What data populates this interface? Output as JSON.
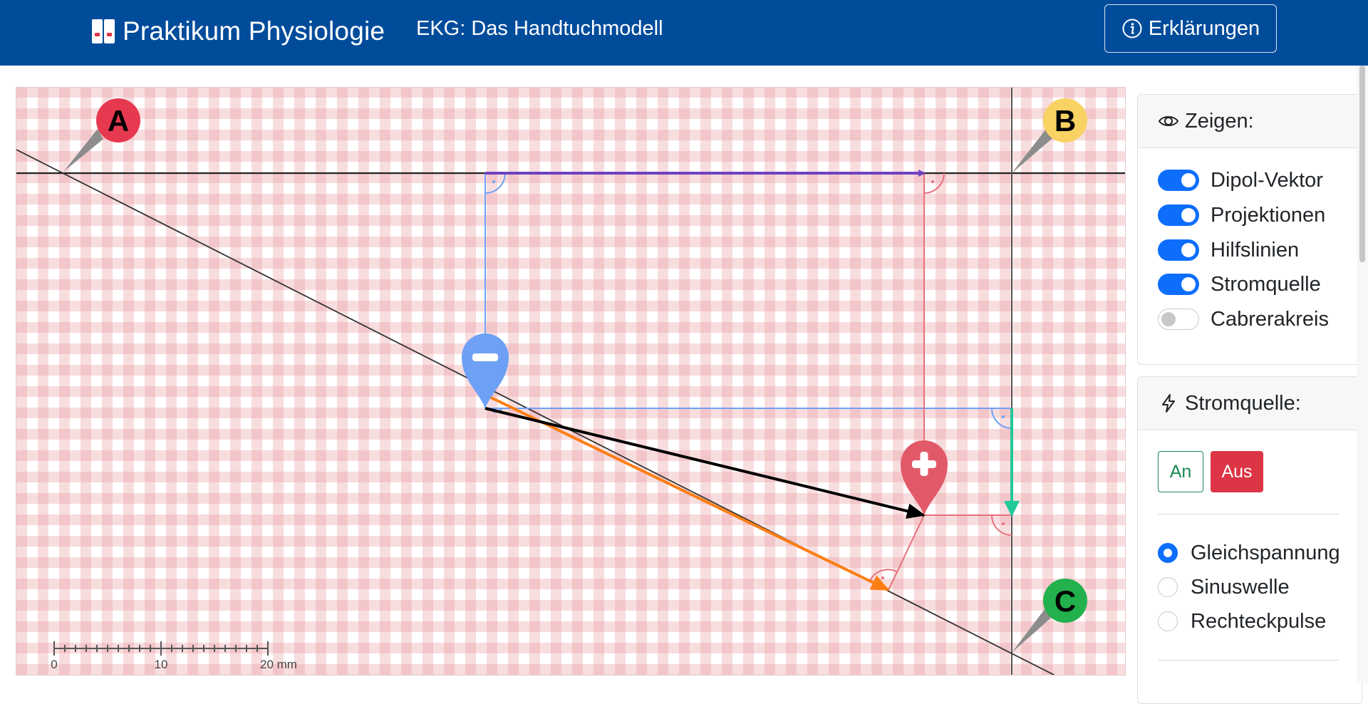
{
  "navbar": {
    "brand": "Praktikum Physiologie",
    "subtitle": "EKG: Das Handtuchmodell",
    "explain_button": "Erklärungen",
    "background_color": "#004c9b"
  },
  "canvas": {
    "markers": {
      "a": "A",
      "b": "B",
      "c": "C",
      "a_color": "#e63950",
      "b_color": "#f8d262",
      "c_color": "#22b14c"
    },
    "dipole_poles": {
      "negative_icon": "minus-icon",
      "positive_icon": "plus-icon",
      "negative_color": "#6ea1f5",
      "positive_color": "#e25a6a"
    },
    "vector_colors": {
      "dipole": "#000000",
      "projection_ab": "#6f42c1",
      "projection_bc": "#20c997",
      "projection_ac": "#fd7e14",
      "helper_blue": "#6ea1f5",
      "helper_red": "#e8707c"
    },
    "scale": {
      "tick0": "0",
      "tick10": "10",
      "tick20": "20 mm"
    }
  },
  "sidebar": {
    "show": {
      "title": "Zeigen:",
      "icon": "eye-icon",
      "toggles": [
        {
          "label": "Dipol-Vektor",
          "on": true
        },
        {
          "label": "Projektionen",
          "on": true
        },
        {
          "label": "Hilfslinien",
          "on": true
        },
        {
          "label": "Stromquelle",
          "on": true
        },
        {
          "label": "Cabrerakreis",
          "on": false
        }
      ]
    },
    "source": {
      "title": "Stromquelle:",
      "icon": "lightning-icon",
      "on_label": "An",
      "off_label": "Aus",
      "waveforms": [
        {
          "label": "Gleichspannung",
          "checked": true
        },
        {
          "label": "Sinuswelle",
          "checked": false
        },
        {
          "label": "Rechteckpulse",
          "checked": false
        }
      ]
    }
  }
}
